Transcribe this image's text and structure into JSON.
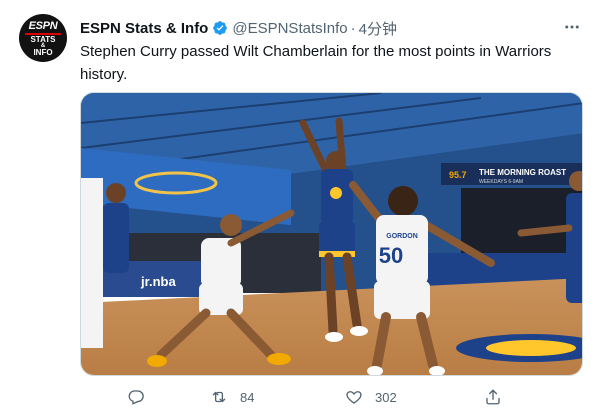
{
  "tweet": {
    "avatar": {
      "line1": "ESPN",
      "line2": "STATS",
      "line3": "&",
      "line4": "INFO"
    },
    "author_name": "ESPN Stats & Info",
    "handle": "@ESPNStatsInfo",
    "separator": "·",
    "time": "4分钟",
    "text": "Stephen Curry passed Wilt Chamberlain for the most points in Warriors history.",
    "media": {
      "scoreboard_logo": "95.7",
      "banner_title": "THE MORNING ROAST",
      "banner_sub": "WEEKDAYS 6-9AM",
      "jersey_number": "50",
      "jersey_name": "GORDON",
      "court_ad": "jr.nba"
    },
    "actions": {
      "reply": {
        "icon": "reply-icon",
        "count": ""
      },
      "retweet": {
        "icon": "retweet-icon",
        "count": "84"
      },
      "like": {
        "icon": "heart-icon",
        "count": "302"
      },
      "share": {
        "icon": "share-icon",
        "count": ""
      }
    }
  },
  "colors": {
    "verified": "#1d9bf0",
    "muted": "#536471",
    "text": "#0f1419",
    "warriors_blue": "#1d428a",
    "warriors_gold": "#ffc72c"
  }
}
